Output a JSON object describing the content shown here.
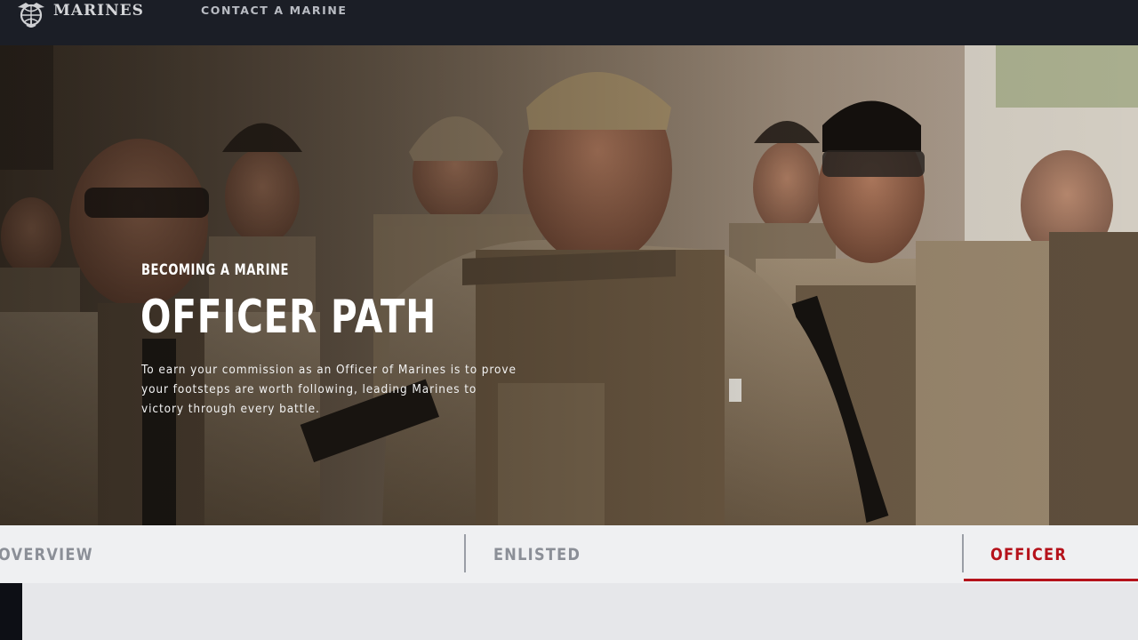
{
  "header": {
    "logo_text": "MARINES",
    "nav_links": [
      {
        "label": "CONTACT A MARINE"
      }
    ]
  },
  "hero": {
    "eyebrow": "BECOMING A MARINE",
    "title": "OFFICER PATH",
    "description": "To earn your commission as an Officer of Marines is to prove your footsteps are worth following, leading Marines to victory through every battle."
  },
  "tabs": [
    {
      "label": "OVERVIEW",
      "active": false
    },
    {
      "label": "ENLISTED",
      "active": false
    },
    {
      "label": "OFFICER",
      "active": true
    }
  ],
  "colors": {
    "nav_background": "#1b1e26",
    "active_tab": "#b5121b",
    "inactive_tab": "#8b8f97",
    "tab_bar": "#eff0f2"
  },
  "icons": {
    "logo": "eagle-globe-anchor-emblem"
  }
}
